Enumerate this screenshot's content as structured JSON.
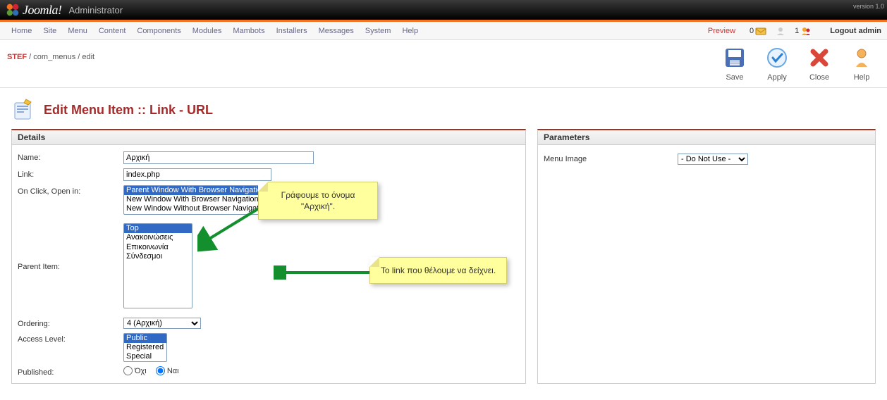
{
  "header": {
    "brand": "Joomla!",
    "subtitle": "Administrator",
    "version": "version 1.0"
  },
  "menu": {
    "items": [
      "Home",
      "Site",
      "Menu",
      "Content",
      "Components",
      "Modules",
      "Mambots",
      "Installers",
      "Messages",
      "System",
      "Help"
    ],
    "preview": "Preview",
    "mail_count": "0",
    "user_count": "1",
    "logout": "Logout admin"
  },
  "breadcrumb": {
    "first": "STEF",
    "rest": " / com_menus / edit"
  },
  "toolbar": {
    "save": "Save",
    "apply": "Apply",
    "close": "Close",
    "help": "Help"
  },
  "page_title": {
    "main": "Edit Menu Item",
    "suffix": " :: Link - URL"
  },
  "details": {
    "heading": "Details",
    "name_label": "Name:",
    "name_value": "Αρχική",
    "link_label": "Link:",
    "link_value": "index.php",
    "openin_label": "On Click, Open in:",
    "openin_options": [
      "Parent Window With Browser Navigation",
      "New Window With Browser Navigation",
      "New Window Without Browser Navigation"
    ],
    "parent_label": "Parent Item:",
    "parent_options": [
      "Top",
      "Ανακοινώσεις",
      "Επικοινωνία",
      "Σύνδεσμοι"
    ],
    "ordering_label": "Ordering:",
    "ordering_value": "4 (Αρχική)",
    "access_label": "Access Level:",
    "access_options": [
      "Public",
      "Registered",
      "Special"
    ],
    "published_label": "Published:",
    "published_no": "Όχι",
    "published_yes": "Ναι"
  },
  "parameters": {
    "heading": "Parameters",
    "menu_image_label": "Menu Image",
    "menu_image_value": "- Do Not Use -"
  },
  "annotations": {
    "note1": "Γράφουμε το όνομα \"Αρχική\".",
    "note2": "Το link που θέλουμε να δείχνει."
  }
}
